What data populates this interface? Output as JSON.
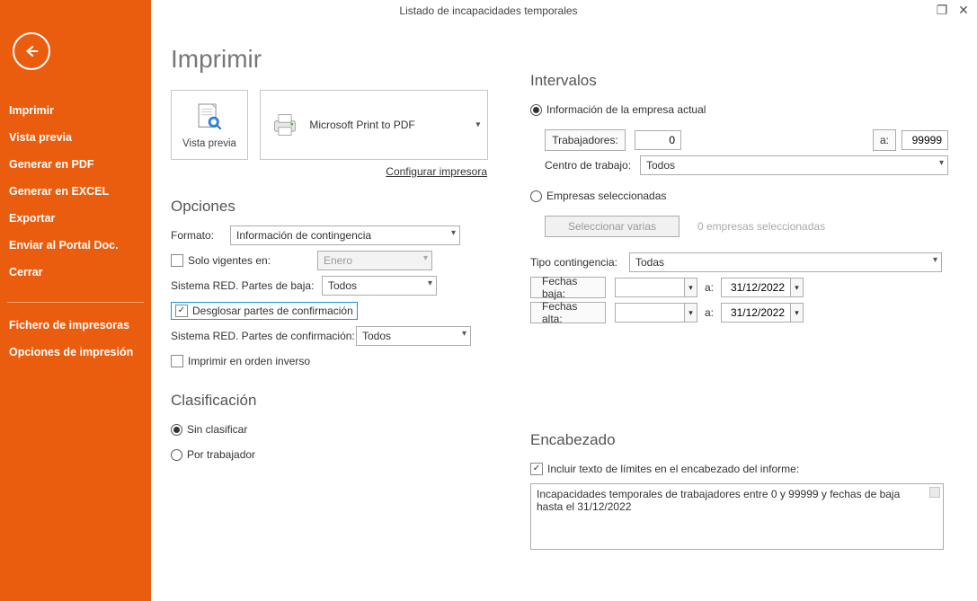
{
  "window": {
    "title": "Listado de incapacidades temporales"
  },
  "nav": {
    "items": [
      "Imprimir",
      "Vista previa",
      "Generar en PDF",
      "Generar en EXCEL",
      "Exportar",
      "Enviar al Portal Doc.",
      "Cerrar"
    ],
    "items2": [
      "Fichero de impresoras",
      "Opciones de impresión"
    ]
  },
  "header": {
    "title": "Imprimir"
  },
  "preview": {
    "label": "Vista previa"
  },
  "printer": {
    "name": "Microsoft Print to PDF",
    "configure": "Configurar impresora"
  },
  "opciones": {
    "title": "Opciones",
    "formato_label": "Formato:",
    "formato_value": "Información de contingencia",
    "solo_vigentes": "Solo vigentes en:",
    "mes": "Enero",
    "sis_baja_label": "Sistema RED. Partes de baja:",
    "todos": "Todos",
    "desglosar": "Desglosar partes de confirmación",
    "sis_conf_label": "Sistema RED. Partes de confirmación:",
    "inverso": "Imprimir en orden inverso"
  },
  "clasif": {
    "title": "Clasificación",
    "sin": "Sin clasificar",
    "por": "Por trabajador"
  },
  "intervalos": {
    "title": "Intervalos",
    "info_empresa": "Información de la empresa actual",
    "trab_btn": "Trabajadores:",
    "trab_from": "0",
    "a": "a:",
    "trab_to": "99999",
    "centro_label": "Centro de trabajo:",
    "centro_value": "Todos",
    "emp_sel": "Empresas seleccionadas",
    "sel_varias": "Seleccionar varias",
    "sel_count": "0 empresas seleccionadas",
    "tipo_label": "Tipo contingencia:",
    "tipo_value": "Todas",
    "fechas_baja": "Fechas baja:",
    "fechas_alta": "Fechas alta:",
    "d1": "31/12/2022",
    "d2": "31/12/2022"
  },
  "encabezado": {
    "title": "Encabezado",
    "chk": "Incluir texto de límites en el encabezado del informe:",
    "text": "Incapacidades temporales de trabajadores entre 0 y 99999 y fechas de baja hasta el 31/12/2022"
  }
}
